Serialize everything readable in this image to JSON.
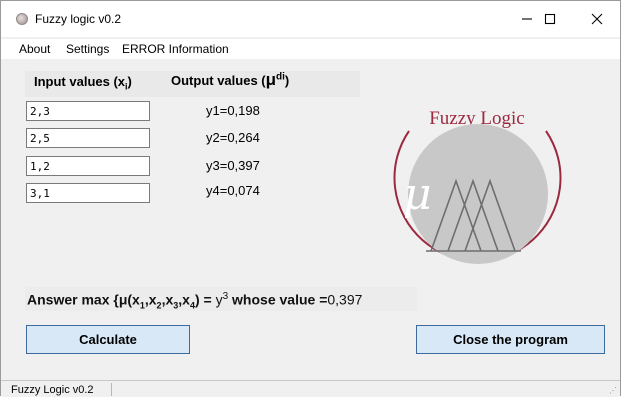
{
  "window": {
    "title": "Fuzzy logic v0.2",
    "controls": [
      "minimize-icon",
      "maximize-icon",
      "close-icon"
    ]
  },
  "menu": {
    "items": [
      "About",
      "Settings",
      "ERROR Information"
    ]
  },
  "headers": {
    "input_label": "Input values  (x",
    "input_sub": "i",
    "input_close": ")",
    "output_label": "Output values (",
    "output_mu": "μ",
    "output_sup": "di",
    "output_close": ")"
  },
  "inputs": [
    {
      "value": "2,3"
    },
    {
      "value": "2,5"
    },
    {
      "value": "1,2"
    },
    {
      "value": "3,1"
    }
  ],
  "outputs": [
    "y1=0,198",
    "y2=0,264",
    "y3=0,397",
    "y4=0,074"
  ],
  "answer": {
    "prefix": "Answer max {μ(x",
    "s1": "1",
    "c1": ",x",
    "s2": "2",
    "c2": ",x",
    "s3": "3",
    "c3": ",x",
    "s4": "4",
    "eq": ") = ",
    "y": "y",
    "ysup": "3",
    "suffix": " whose value =",
    "value": "0,397"
  },
  "buttons": {
    "calculate": "Calculate",
    "close": "Close the program"
  },
  "logo": {
    "text": "Fuzzy Logic",
    "symbol": "μ"
  },
  "statusbar": {
    "text": "Fuzzy Logic v0.2"
  },
  "colors": {
    "logo_text": "#9b2a3f",
    "logo_arc": "#9b2a3f",
    "logo_disc": "#c8c8c8",
    "button_bg": "#d9e8f7",
    "button_border": "#3d6a9c"
  }
}
